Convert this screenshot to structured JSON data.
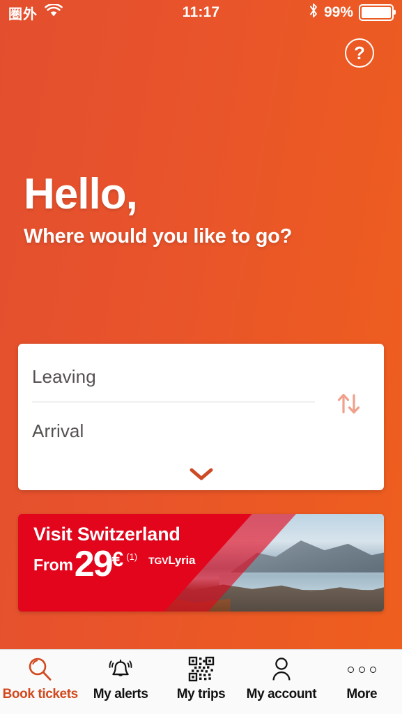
{
  "statusbar": {
    "carrier": "圏外",
    "wifi_icon": "wifi-icon",
    "time": "11:17",
    "bluetooth_icon": "bluetooth-icon",
    "battery_pct": "99%",
    "battery_icon": "battery-full-icon"
  },
  "header": {
    "help_label": "?",
    "help_icon": "help-circle-icon"
  },
  "hero": {
    "greeting": "Hello,",
    "question": "Where would you like to go?"
  },
  "search_card": {
    "leaving_placeholder": "Leaving",
    "arrival_placeholder": "Arrival",
    "swap_icon": "swap-vertical-arrows-icon",
    "expand_icon": "chevron-down-icon",
    "swap_color": "#efa18c",
    "expand_color": "#cc4a26"
  },
  "promo": {
    "title": "Visit Switzerland",
    "from_label": "From",
    "amount": "29",
    "currency": "€",
    "footnote": "(1)",
    "brand_prefix": "TGV",
    "brand_name": "Lyria",
    "red": "#e3051b"
  },
  "tabbar": {
    "items": [
      {
        "label": "Book tickets",
        "icon": "search-magnifier-icon",
        "active": true
      },
      {
        "label": "My alerts",
        "icon": "bell-ringing-icon",
        "active": false
      },
      {
        "label": "My trips",
        "icon": "qr-code-icon",
        "active": false
      },
      {
        "label": "My account",
        "icon": "person-icon",
        "active": false
      },
      {
        "label": "More",
        "icon": "three-dots-icon",
        "active": false
      }
    ]
  },
  "theme": {
    "background_left": "#e34f2e",
    "background_right": "#ef5f1d",
    "accent": "#d2481e",
    "card_bg": "#ffffff",
    "tabbar_bg": "#fafafa"
  }
}
